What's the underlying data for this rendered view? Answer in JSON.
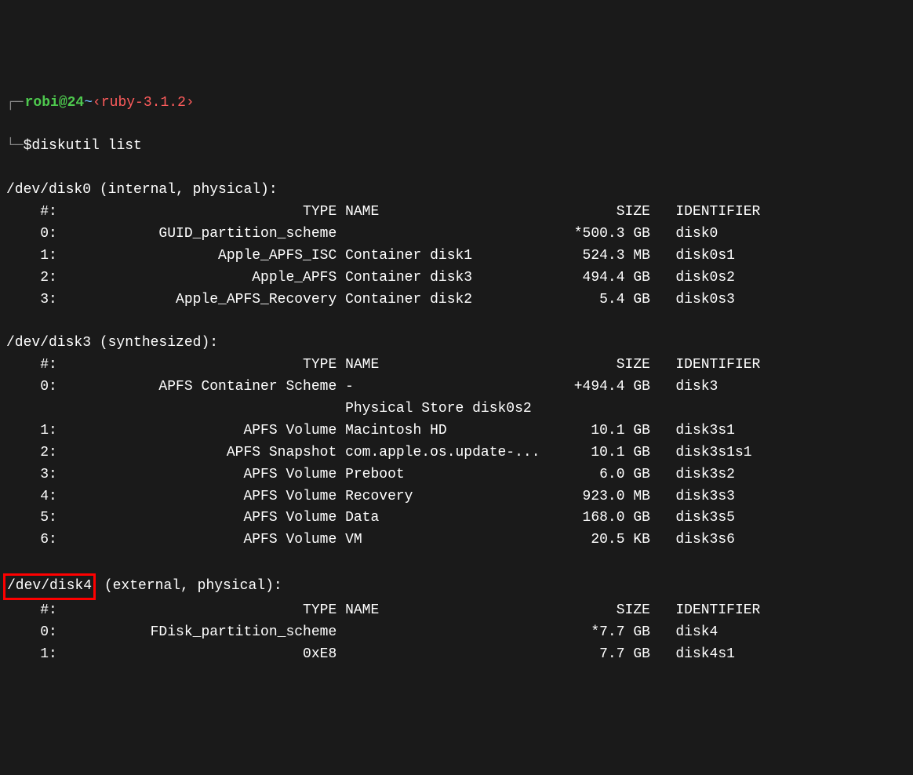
{
  "prompt": {
    "user_host": "robi@24",
    "tilde": "~",
    "ruby_version": "‹ruby-3.1.2›"
  },
  "command_line": {
    "dollar": "$",
    "command": "diskutil list"
  },
  "disks": [
    {
      "header": "/dev/disk0 (internal, physical):",
      "highlighted": false,
      "columns": {
        "idx": "#:",
        "type": "TYPE",
        "name": "NAME",
        "size": "SIZE",
        "identifier": "IDENTIFIER"
      },
      "rows": [
        {
          "idx": "0:",
          "type": "GUID_partition_scheme",
          "name": "",
          "size": "*500.3 GB",
          "identifier": "disk0"
        },
        {
          "idx": "1:",
          "type": "Apple_APFS_ISC",
          "name": "Container disk1",
          "size": "524.3 MB",
          "identifier": "disk0s1"
        },
        {
          "idx": "2:",
          "type": "Apple_APFS",
          "name": "Container disk3",
          "size": "494.4 GB",
          "identifier": "disk0s2"
        },
        {
          "idx": "3:",
          "type": "Apple_APFS_Recovery",
          "name": "Container disk2",
          "size": "5.4 GB",
          "identifier": "disk0s3"
        }
      ]
    },
    {
      "header": "/dev/disk3 (synthesized):",
      "highlighted": false,
      "columns": {
        "idx": "#:",
        "type": "TYPE",
        "name": "NAME",
        "size": "SIZE",
        "identifier": "IDENTIFIER"
      },
      "rows": [
        {
          "idx": "0:",
          "type": "APFS Container Scheme",
          "name": "-",
          "size": "+494.4 GB",
          "identifier": "disk3"
        },
        {
          "idx": "",
          "type": "",
          "name": "Physical Store disk0s2",
          "size": "",
          "identifier": ""
        },
        {
          "idx": "1:",
          "type": "APFS Volume",
          "name": "Macintosh HD",
          "size": "10.1 GB",
          "identifier": "disk3s1"
        },
        {
          "idx": "2:",
          "type": "APFS Snapshot",
          "name": "com.apple.os.update-...",
          "size": "10.1 GB",
          "identifier": "disk3s1s1"
        },
        {
          "idx": "3:",
          "type": "APFS Volume",
          "name": "Preboot",
          "size": "6.0 GB",
          "identifier": "disk3s2"
        },
        {
          "idx": "4:",
          "type": "APFS Volume",
          "name": "Recovery",
          "size": "923.0 MB",
          "identifier": "disk3s3"
        },
        {
          "idx": "5:",
          "type": "APFS Volume",
          "name": "Data",
          "size": "168.0 GB",
          "identifier": "disk3s5"
        },
        {
          "idx": "6:",
          "type": "APFS Volume",
          "name": "VM",
          "size": "20.5 KB",
          "identifier": "disk3s6"
        }
      ]
    },
    {
      "header_a": "/dev/disk4",
      "header_b": " (external, physical):",
      "highlighted": true,
      "columns": {
        "idx": "#:",
        "type": "TYPE",
        "name": "NAME",
        "size": "SIZE",
        "identifier": "IDENTIFIER"
      },
      "rows": [
        {
          "idx": "0:",
          "type": "FDisk_partition_scheme",
          "name": "",
          "size": "*7.7 GB",
          "identifier": "disk4"
        },
        {
          "idx": "1:",
          "type": "0xE8",
          "name": "",
          "size": "7.7 GB",
          "identifier": "disk4s1"
        }
      ]
    }
  ]
}
